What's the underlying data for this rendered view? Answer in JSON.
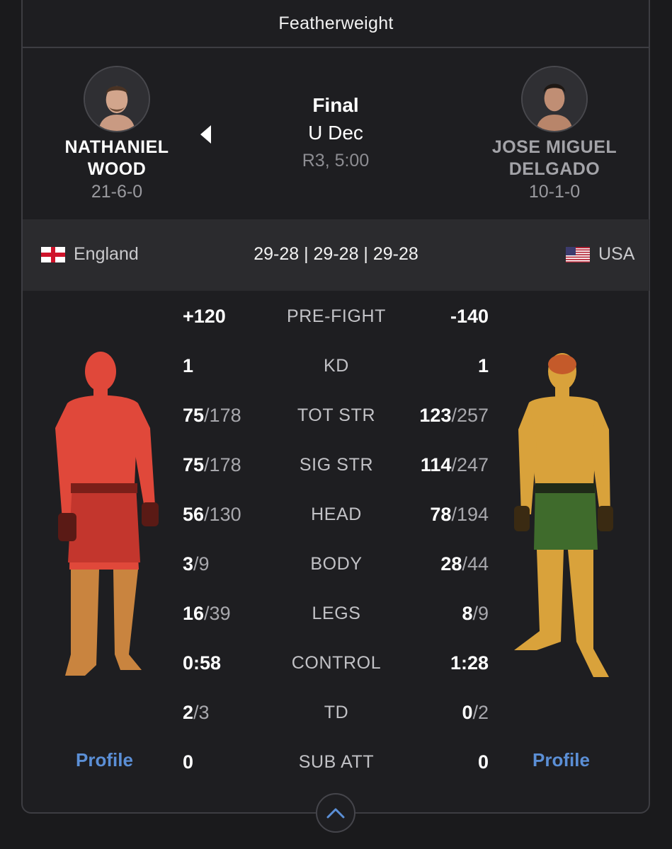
{
  "weight_class": "Featherweight",
  "result": {
    "status": "Final",
    "method": "U Dec",
    "time": "R3, 5:00"
  },
  "fighters": {
    "left": {
      "first_name": "NATHANIEL",
      "last_name": "WOOD",
      "record": "21-6-0",
      "country": "England",
      "winner": true,
      "profile_label": "Profile",
      "body_tint": "#d9463a"
    },
    "right": {
      "first_name": "JOSE MIGUEL",
      "last_name": "DELGADO",
      "record": "10-1-0",
      "country": "USA",
      "winner": false,
      "profile_label": "Profile",
      "body_tint": "#d9a23b"
    }
  },
  "judges_scores": "29-28 | 29-28 | 29-28",
  "stats": [
    {
      "label": "PRE-FIGHT",
      "left": "+120",
      "left_of": "",
      "right": "-140",
      "right_of": ""
    },
    {
      "label": "KD",
      "left": "1",
      "left_of": "",
      "right": "1",
      "right_of": ""
    },
    {
      "label": "TOT STR",
      "left": "75",
      "left_of": "/178",
      "right": "123",
      "right_of": "/257"
    },
    {
      "label": "SIG STR",
      "left": "75",
      "left_of": "/178",
      "right": "114",
      "right_of": "/247"
    },
    {
      "label": "HEAD",
      "left": "56",
      "left_of": "/130",
      "right": "78",
      "right_of": "/194"
    },
    {
      "label": "BODY",
      "left": "3",
      "left_of": "/9",
      "right": "28",
      "right_of": "/44"
    },
    {
      "label": "LEGS",
      "left": "16",
      "left_of": "/39",
      "right": "8",
      "right_of": "/9"
    },
    {
      "label": "CONTROL",
      "left": "0:58",
      "left_of": "",
      "right": "1:28",
      "right_of": ""
    },
    {
      "label": "TD",
      "left": "2",
      "left_of": "/3",
      "right": "0",
      "right_of": "/2"
    },
    {
      "label": "SUB ATT",
      "left": "0",
      "left_of": "",
      "right": "0",
      "right_of": ""
    }
  ],
  "icons": {
    "winner_indicator": "caret-left-icon",
    "collapse": "chevron-up-icon",
    "flag_left": "england-flag-icon",
    "flag_right": "usa-flag-icon"
  },
  "colors": {
    "accent": "#5b8fd6",
    "background": "#1a1a1c",
    "info_bar": "#2b2b2e"
  }
}
